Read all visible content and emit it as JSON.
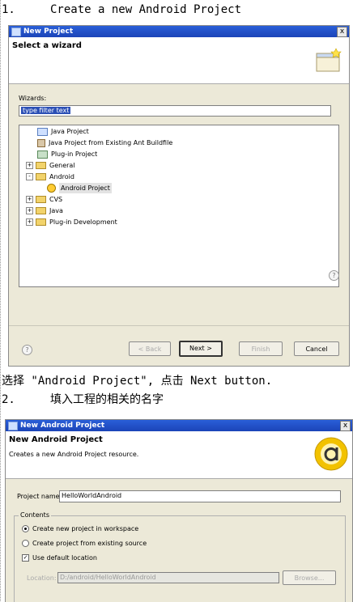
{
  "doc": {
    "step1_num": "1.",
    "step1_text": "Create a new Android Project",
    "instruction": "选择 \"Android Project\", 点击 Next button.",
    "step2_num": "2.",
    "step2_text": "填入工程的相关的名字"
  },
  "dialog1": {
    "title": "New Project",
    "close": "x",
    "banner_title": "Select a wizard",
    "wizards_label": "Wizards:",
    "filter_value": "type filter text",
    "tree": [
      {
        "label": "Java Project",
        "icon": "java-project-icon"
      },
      {
        "label": "Java Project from Existing Ant Buildfile",
        "icon": "ant-icon"
      },
      {
        "label": "Plug-in Project",
        "icon": "plugin-project-icon"
      },
      {
        "label": "General",
        "icon": "folder-icon",
        "expander": "+"
      },
      {
        "label": "Android",
        "icon": "folder-icon",
        "expander": "-"
      },
      {
        "label": "Android Project",
        "icon": "android-project-icon"
      },
      {
        "label": "CVS",
        "icon": "folder-icon",
        "expander": "+"
      },
      {
        "label": "Java",
        "icon": "folder-icon",
        "expander": "+"
      },
      {
        "label": "Plug-in Development",
        "icon": "folder-icon",
        "expander": "+"
      }
    ],
    "help_glyph": "?",
    "buttons": {
      "back": "< Back",
      "next": "Next >",
      "finish": "Finish",
      "cancel": "Cancel"
    }
  },
  "dialog2": {
    "title": "New Android Project",
    "close": "x",
    "banner_title": "New Android Project",
    "banner_subtitle": "Creates a new Android Project resource.",
    "project_name_label": "Project name:",
    "project_name_value": "HelloWorldAndroid",
    "contents_label": "Contents",
    "option_new": "Create new project in workspace",
    "option_existing": "Create project from existing source",
    "use_default": "Use default location",
    "location_label": "Location:",
    "location_value": "D:/android/HelloWorldAndroid",
    "browse": "Browse..."
  },
  "colors": {
    "titlebar": "#1b44b8",
    "dialog_bg": "#ece9d8"
  }
}
